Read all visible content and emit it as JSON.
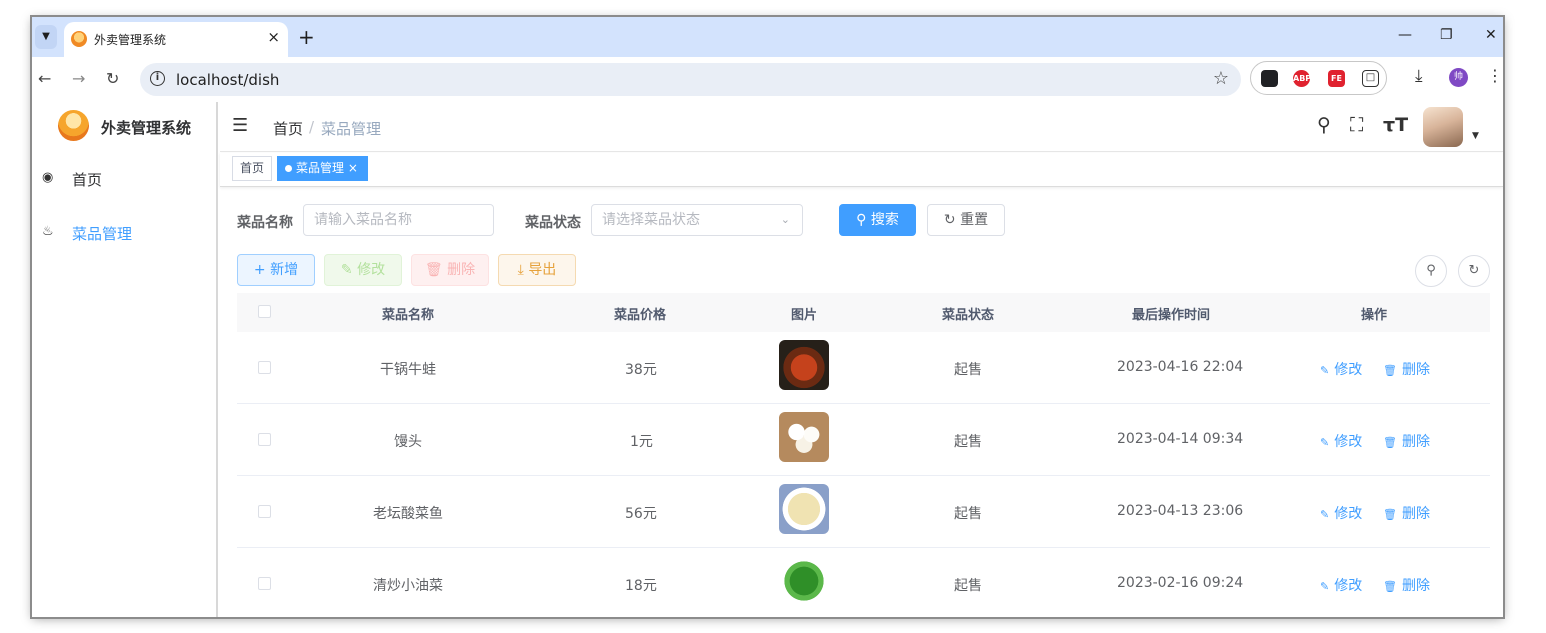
{
  "browser": {
    "tab_title": "外卖管理系统",
    "tab_close": "×",
    "new_tab": "+",
    "url": "localhost/dish",
    "window_controls": [
      "—",
      "❐",
      "✕"
    ],
    "extensions": [
      {
        "name": "tabs-extension-icon",
        "label": "▪",
        "color": "#202124"
      },
      {
        "name": "adblock-plus-icon",
        "label": "ABP",
        "color": "#e0222f"
      },
      {
        "name": "fe-helper-icon",
        "label": "FE",
        "color": "#e0222f"
      },
      {
        "name": "extensions-puzzle-icon",
        "label": "⧉",
        "color": "#ffffff"
      }
    ],
    "profile_initial": "帅"
  },
  "sidebar": {
    "brand": "外卖管理系统",
    "items": [
      {
        "label": "首页",
        "icon": "dashboard-icon",
        "active": false
      },
      {
        "label": "菜品管理",
        "icon": "dish-icon",
        "active": true
      }
    ]
  },
  "header": {
    "breadcrumb": [
      "首页",
      "/",
      "菜品管理"
    ]
  },
  "tags": {
    "home": "首页",
    "active": "菜品管理",
    "active_close": "×"
  },
  "search": {
    "name_label": "菜品名称",
    "name_placeholder": "请输入菜品名称",
    "status_label": "菜品状态",
    "status_placeholder": "请选择菜品状态",
    "search_button": "搜索",
    "reset_button": "重置"
  },
  "actions": {
    "add": "新增",
    "edit": "修改",
    "delete": "删除",
    "export": "导出"
  },
  "table": {
    "columns": [
      "菜品名称",
      "菜品价格",
      "图片",
      "菜品状态",
      "最后操作时间",
      "操作"
    ],
    "rows": [
      {
        "name": "干锅牛蛙",
        "price": "38元",
        "status": "起售",
        "time": "2023-04-16 22:04",
        "edit": "修改",
        "delete": "删除"
      },
      {
        "name": "馒头",
        "price": "1元",
        "status": "起售",
        "time": "2023-04-14 09:34",
        "edit": "修改",
        "delete": "删除"
      },
      {
        "name": "老坛酸菜鱼",
        "price": "56元",
        "status": "起售",
        "time": "2023-04-13 23:06",
        "edit": "修改",
        "delete": "删除"
      },
      {
        "name": "清炒小油菜",
        "price": "18元",
        "status": "起售",
        "time": "2023-02-16 09:24",
        "edit": "修改",
        "delete": "删除"
      }
    ]
  },
  "colors": {
    "primary": "#409eff",
    "tab_strip": "#d3e3fd"
  }
}
